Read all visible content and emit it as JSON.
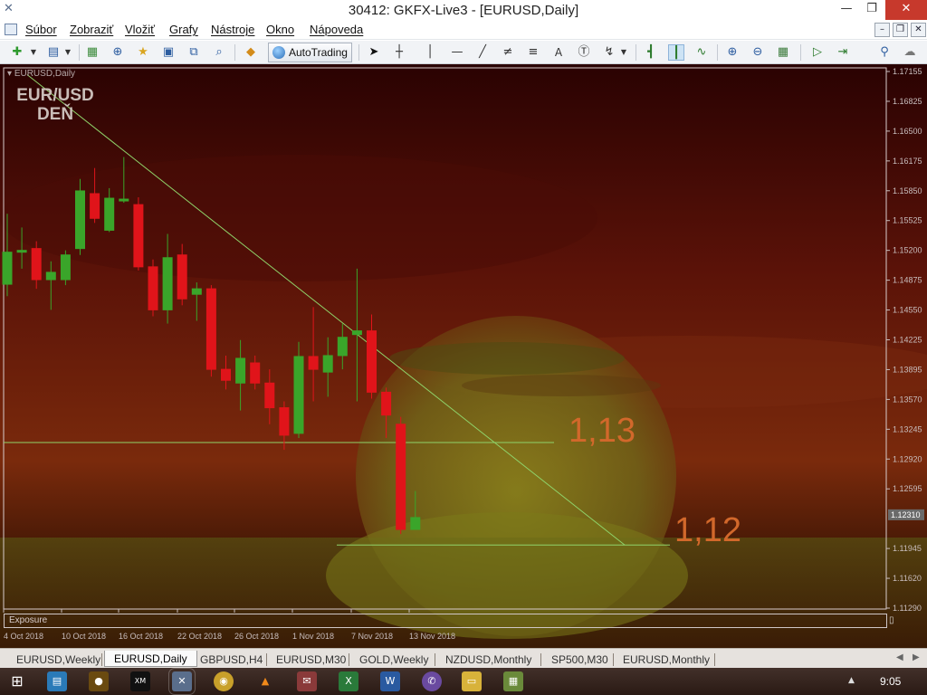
{
  "window": {
    "title": "30412: GKFX-Live3 - [EURUSD,Daily]",
    "minimize_glyph": "—",
    "restore_glyph": "❐",
    "close_glyph": "✕"
  },
  "menu": {
    "items": [
      "Súbor",
      "Zobraziť",
      "Vložiť",
      "Grafy",
      "Nástroje",
      "Okno",
      "Nápoveda"
    ],
    "mdi_minimize": "–",
    "mdi_restore": "❐",
    "mdi_close": "✕"
  },
  "toolbar": {
    "autotrading_label": "AutoTrading",
    "icons": [
      "new-chart-icon",
      "profiles-icon",
      "market-watch-icon",
      "crosshair-icon",
      "folder-icon",
      "navigator-icon",
      "terminal-icon",
      "strategy-tester-icon",
      "eraser-icon",
      "autotrading-icon",
      "cursor-icon",
      "crosshair-tool-icon",
      "vertical-line-icon",
      "horizontal-line-icon",
      "trendline-icon",
      "channel-icon",
      "fibonacci-icon",
      "text-icon",
      "text-label-icon",
      "arrows-icon",
      "bar-chart-icon",
      "candlestick-icon",
      "line-chart-icon",
      "zoom-in-icon",
      "zoom-out-icon",
      "tile-windows-icon",
      "autoscroll-icon",
      "chart-shift-icon",
      "search-icon",
      "chat-icon"
    ]
  },
  "chart": {
    "symbol_label": "EURUSD,Daily",
    "overlay_title_line1": "EUR/USD",
    "overlay_title_line2": "DEŇ",
    "annotation_upper": "1,13",
    "annotation_lower": "1,12",
    "current_price": "1.12310",
    "exposure_label": "Exposure",
    "colors": {
      "bull": "#3aa52a",
      "bear": "#e0141a",
      "line": "#8fd36a",
      "price_box": "#6a6a6a"
    }
  },
  "chart_data": {
    "type": "candlestick",
    "y_ticks": [
      "1.17155",
      "1.16825",
      "1.16500",
      "1.16175",
      "1.15850",
      "1.15525",
      "1.15200",
      "1.14875",
      "1.14550",
      "1.14225",
      "1.13895",
      "1.13570",
      "1.13245",
      "1.12920",
      "1.12595",
      "1.12310",
      "1.11945",
      "1.11620",
      "1.11290"
    ],
    "x_ticks": [
      "4 Oct 2018",
      "10 Oct 2018",
      "16 Oct 2018",
      "22 Oct 2018",
      "26 Oct 2018",
      "1 Nov 2018",
      "7 Nov 2018",
      "13 Nov 2018"
    ],
    "ylim": [
      1.1129,
      1.17155
    ],
    "candles": [
      {
        "o": 1.1483,
        "h": 1.156,
        "l": 1.147,
        "c": 1.1518
      },
      {
        "o": 1.1518,
        "h": 1.1545,
        "l": 1.15,
        "c": 1.152
      },
      {
        "o": 1.1522,
        "h": 1.153,
        "l": 1.1478,
        "c": 1.1488
      },
      {
        "o": 1.1488,
        "h": 1.1508,
        "l": 1.1455,
        "c": 1.1496
      },
      {
        "o": 1.1488,
        "h": 1.152,
        "l": 1.1482,
        "c": 1.1515
      },
      {
        "o": 1.1522,
        "h": 1.1598,
        "l": 1.1515,
        "c": 1.1585
      },
      {
        "o": 1.1582,
        "h": 1.161,
        "l": 1.155,
        "c": 1.1555
      },
      {
        "o": 1.1542,
        "h": 1.1588,
        "l": 1.154,
        "c": 1.1577
      },
      {
        "o": 1.1575,
        "h": 1.1622,
        "l": 1.1572,
        "c": 1.1576
      },
      {
        "o": 1.157,
        "h": 1.1578,
        "l": 1.1498,
        "c": 1.1502
      },
      {
        "o": 1.1502,
        "h": 1.151,
        "l": 1.1448,
        "c": 1.1455
      },
      {
        "o": 1.1455,
        "h": 1.1538,
        "l": 1.144,
        "c": 1.1512
      },
      {
        "o": 1.1515,
        "h": 1.1527,
        "l": 1.146,
        "c": 1.1467
      },
      {
        "o": 1.1472,
        "h": 1.1485,
        "l": 1.1443,
        "c": 1.1478
      },
      {
        "o": 1.1478,
        "h": 1.1482,
        "l": 1.1382,
        "c": 1.139
      },
      {
        "o": 1.139,
        "h": 1.1405,
        "l": 1.1368,
        "c": 1.1378
      },
      {
        "o": 1.1375,
        "h": 1.1422,
        "l": 1.1345,
        "c": 1.1402
      },
      {
        "o": 1.1397,
        "h": 1.1405,
        "l": 1.1368,
        "c": 1.1375
      },
      {
        "o": 1.1375,
        "h": 1.139,
        "l": 1.133,
        "c": 1.1348
      },
      {
        "o": 1.1348,
        "h": 1.1355,
        "l": 1.1302,
        "c": 1.1318
      },
      {
        "o": 1.132,
        "h": 1.142,
        "l": 1.1315,
        "c": 1.1404
      },
      {
        "o": 1.1404,
        "h": 1.1458,
        "l": 1.1355,
        "c": 1.139
      },
      {
        "o": 1.1387,
        "h": 1.1425,
        "l": 1.136,
        "c": 1.1405
      },
      {
        "o": 1.1405,
        "h": 1.144,
        "l": 1.139,
        "c": 1.1425
      },
      {
        "o": 1.1428,
        "h": 1.15,
        "l": 1.1355,
        "c": 1.1432
      },
      {
        "o": 1.1432,
        "h": 1.145,
        "l": 1.1358,
        "c": 1.1365
      },
      {
        "o": 1.1365,
        "h": 1.137,
        "l": 1.1315,
        "c": 1.134
      },
      {
        "o": 1.133,
        "h": 1.1338,
        "l": 1.121,
        "c": 1.1215
      },
      {
        "o": 1.1215,
        "h": 1.1257,
        "l": 1.1215,
        "c": 1.1228
      }
    ],
    "horizontal_lines": [
      1.131,
      1.1198
    ],
    "trendline": {
      "from_candle": 0,
      "from_price": 1.1712,
      "to_candle": 41,
      "to_price": 1.1198
    }
  },
  "tabs": {
    "items": [
      "EURUSD,Weekly",
      "EURUSD,Daily",
      "GBPUSD,H4",
      "EURUSD,M30",
      "GOLD,Weekly",
      "NZDUSD,Monthly",
      "SP500,M30",
      "EURUSD,Monthly"
    ],
    "active": "EURUSD,Daily",
    "scroll_left": "◀",
    "scroll_right": "▶"
  },
  "taskbar": {
    "start_glyph": "⊞",
    "apps": [
      "store-icon",
      "app-icon-2",
      "xm-icon",
      "metatrader-icon",
      "chrome-icon",
      "vlc-icon",
      "app-icon-7",
      "excel-icon",
      "word-icon",
      "viber-icon",
      "explorer-icon",
      "app-icon-12"
    ],
    "clock": "9:05",
    "tray_glyph": "▲"
  }
}
